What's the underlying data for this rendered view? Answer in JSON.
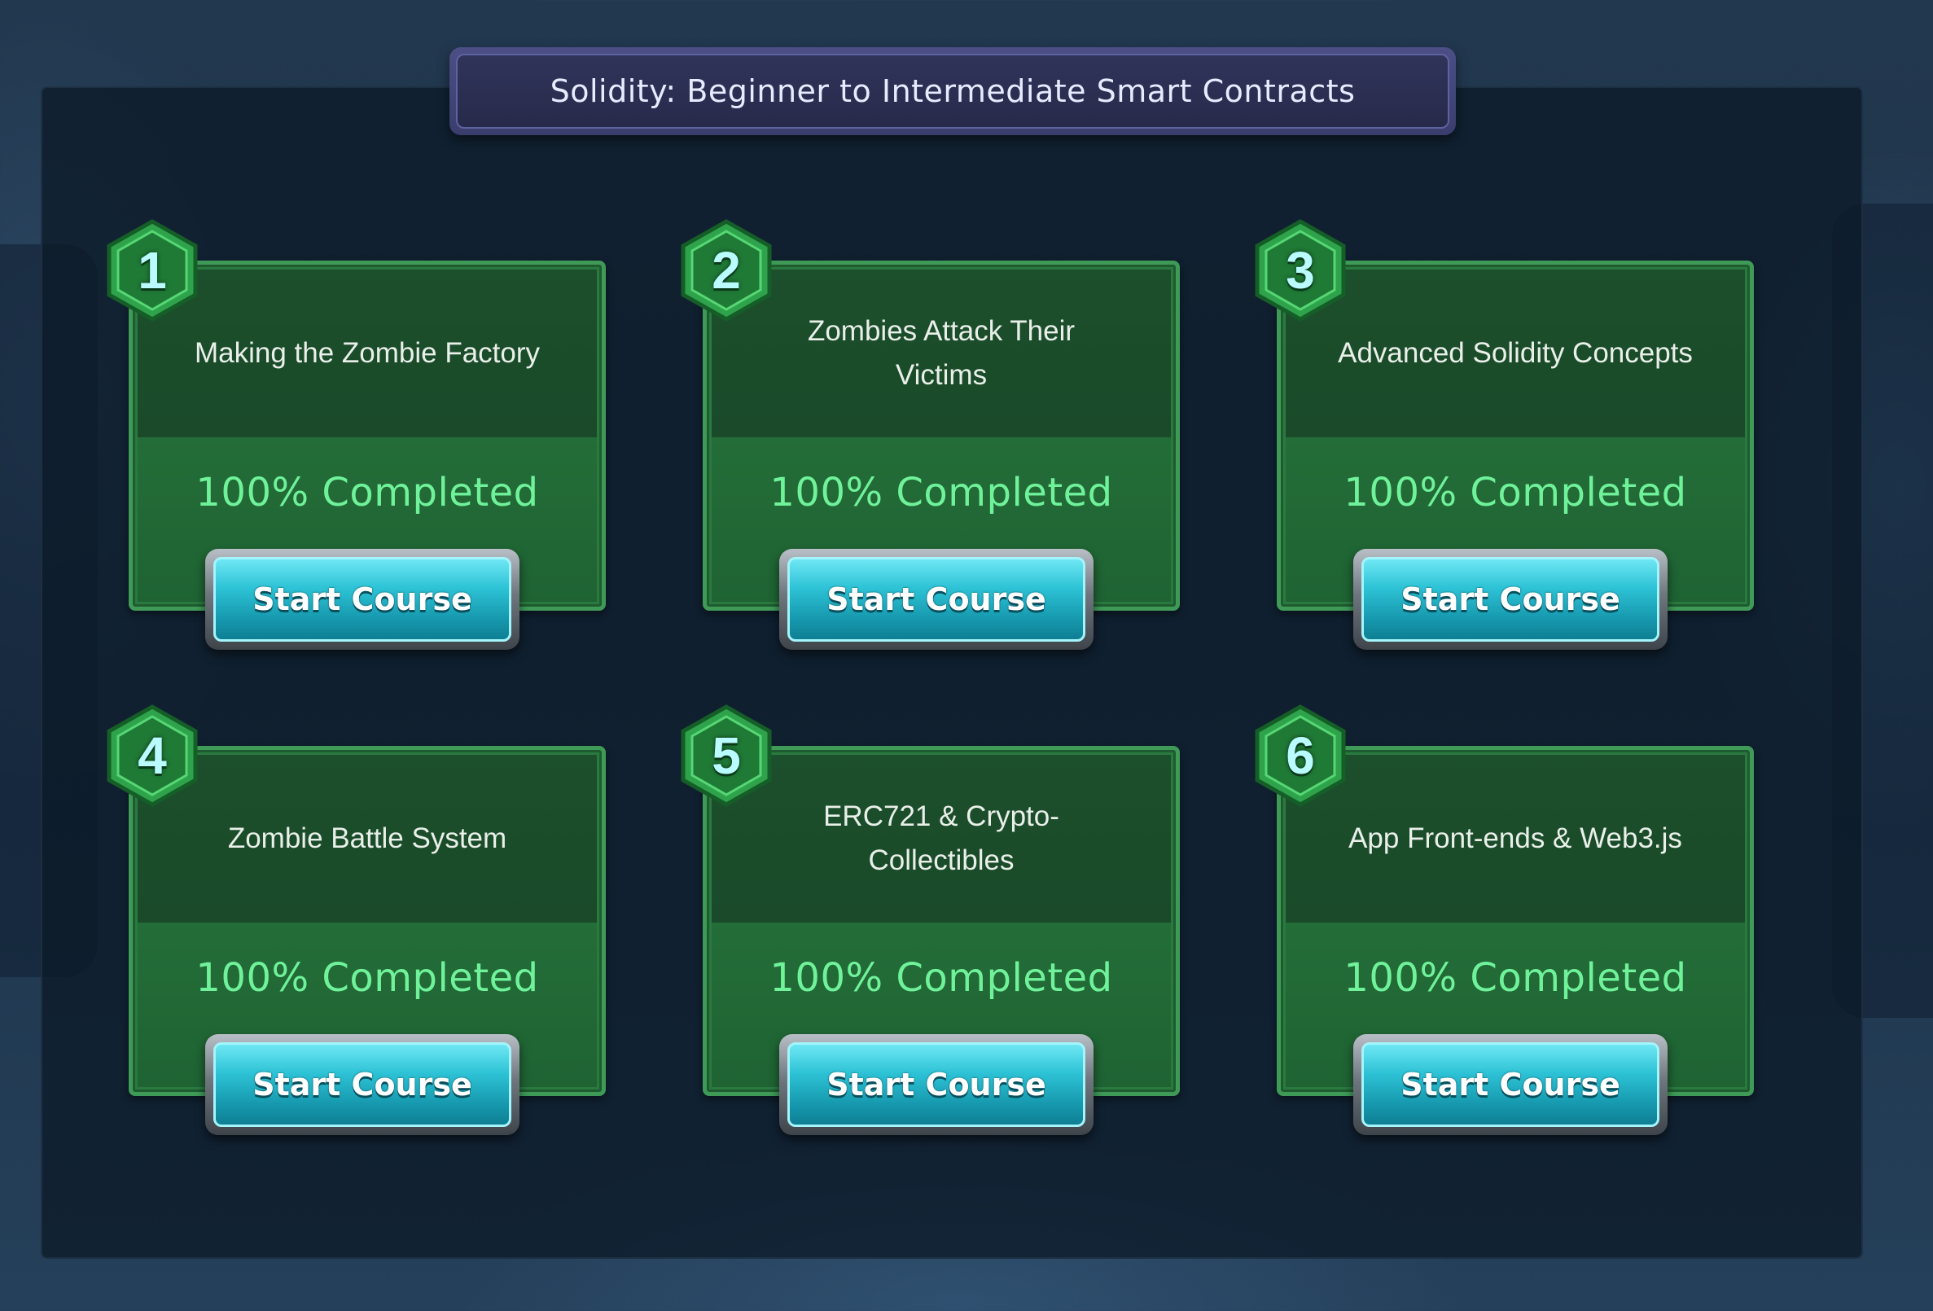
{
  "course": {
    "title": "Solidity: Beginner to Intermediate Smart Contracts"
  },
  "lessons": [
    {
      "number": "1",
      "title": "Making the Zombie Factory",
      "status": "100% Completed",
      "button": "Start Course",
      "progress": 1.0
    },
    {
      "number": "2",
      "title": "Zombies Attack Their Victims",
      "status": "100% Completed",
      "button": "Start Course",
      "progress": 1.0
    },
    {
      "number": "3",
      "title": "Advanced Solidity Concepts",
      "status": "100% Completed",
      "button": "Start Course",
      "progress": 1.0
    },
    {
      "number": "4",
      "title": "Zombie Battle System",
      "status": "100% Completed",
      "button": "Start Course",
      "progress": 1.0
    },
    {
      "number": "5",
      "title": "ERC721 & Crypto-Collectibles",
      "status": "100% Completed",
      "button": "Start Course",
      "progress": 1.0
    },
    {
      "number": "6",
      "title": "App Front-ends & Web3.js",
      "status": "100% Completed",
      "button": "Start Course",
      "progress": 1.0
    }
  ],
  "colors": {
    "badge_fill": "#1f7a36",
    "badge_border": "#4cd36a",
    "status_text": "#6ff29a",
    "button_fill": "#2ec3d6",
    "title_banner": "#3a3d6c"
  }
}
